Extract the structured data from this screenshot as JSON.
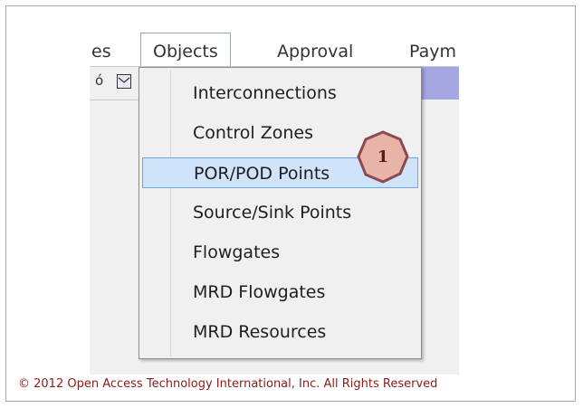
{
  "menubar": {
    "items": [
      {
        "label": "es"
      },
      {
        "label": "Objects"
      },
      {
        "label": "Approval"
      },
      {
        "label": "Paym"
      }
    ]
  },
  "dropdown": {
    "items": [
      {
        "label": "Interconnections"
      },
      {
        "label": "Control Zones"
      },
      {
        "label": "POR/POD Points",
        "selected": true
      },
      {
        "label": "Source/Sink Points"
      },
      {
        "label": "Flowgates"
      },
      {
        "label": "MRD Flowgates"
      },
      {
        "label": "MRD Resources"
      }
    ]
  },
  "callout": {
    "number": "1"
  },
  "footer": {
    "copyright": "© 2012 Open Access Technology International, Inc. All Rights Reserved"
  },
  "colors": {
    "toolbar": "#a5a6e2",
    "selection": "#cfe3fb",
    "badge_fill": "#e8b4a8",
    "badge_stroke": "#8b4a52",
    "footer_text": "#8b1a1a"
  }
}
